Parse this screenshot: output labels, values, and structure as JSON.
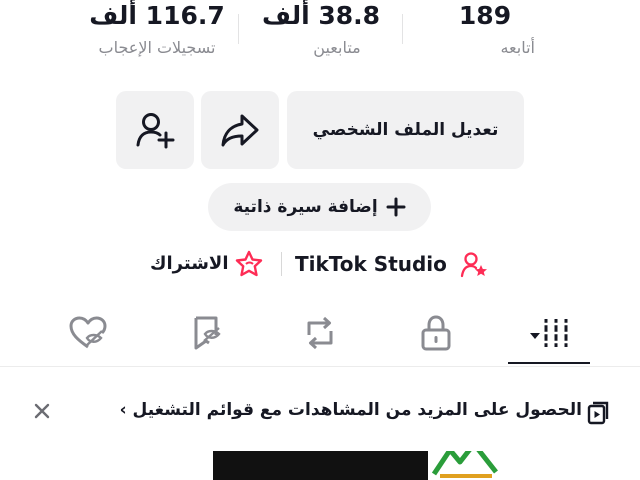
{
  "stats": {
    "following": {
      "value": "189",
      "label": "أتابعه"
    },
    "followers": {
      "value": "38.8 ألف",
      "label": "متابعين"
    },
    "likes": {
      "value": "116.7 ألف",
      "label": "تسجيلات الإعجاب"
    }
  },
  "buttons": {
    "edit_profile": "تعديل الملف الشخصي",
    "add_bio": "إضافة سيرة ذاتية"
  },
  "links": {
    "studio": "TikTok Studio",
    "subscription": "الاشتراك"
  },
  "tabs": [
    "videos-grid",
    "private",
    "reposts",
    "favorites",
    "liked"
  ],
  "banner": {
    "text": "الحصول على المزيد من المشاهدات مع قوائم التشغيل ›"
  },
  "colors": {
    "accent": "#fe2c55",
    "text": "#161823",
    "muted": "#8a8b91",
    "button_bg": "#f1f1f2"
  }
}
